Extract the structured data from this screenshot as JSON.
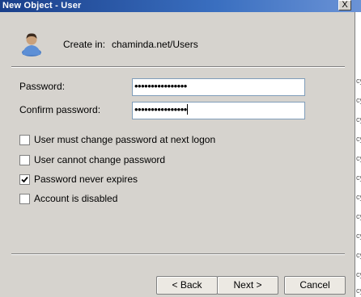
{
  "window": {
    "title": "New Object - User",
    "close_glyph": "X"
  },
  "header": {
    "icon": "user-icon",
    "create_in_label": "Create in:",
    "create_in_value": "chaminda.net/Users"
  },
  "fields": {
    "password_label": "Password:",
    "password_value": "••••••••••••••••",
    "confirm_label": "Confirm password:",
    "confirm_value": "••••••••••••••••"
  },
  "options": [
    {
      "label": "User must change password at next logon",
      "checked": false
    },
    {
      "label": "User cannot change password",
      "checked": false
    },
    {
      "label": "Password never expires",
      "checked": true
    },
    {
      "label": "Account is disabled",
      "checked": false
    }
  ],
  "buttons": {
    "back": "< Back",
    "next": "Next >",
    "cancel": "Cancel"
  },
  "background_strip": [
    "cy",
    "cy",
    "cy",
    "cy",
    "cy",
    "cy",
    "cy",
    "cy",
    "cy",
    "cy",
    "cy",
    "cy"
  ]
}
